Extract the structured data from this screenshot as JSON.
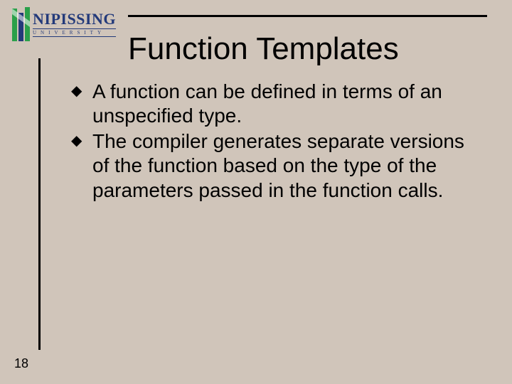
{
  "logo": {
    "word": "NIPISSING",
    "sub": "UNIVERSITY"
  },
  "title": "Function Templates",
  "bullets": [
    "A function can be defined in terms of an unspecified type.",
    "The compiler generates separate versions of the function based on the type of the parameters passed in the function calls."
  ],
  "page_number": "18"
}
